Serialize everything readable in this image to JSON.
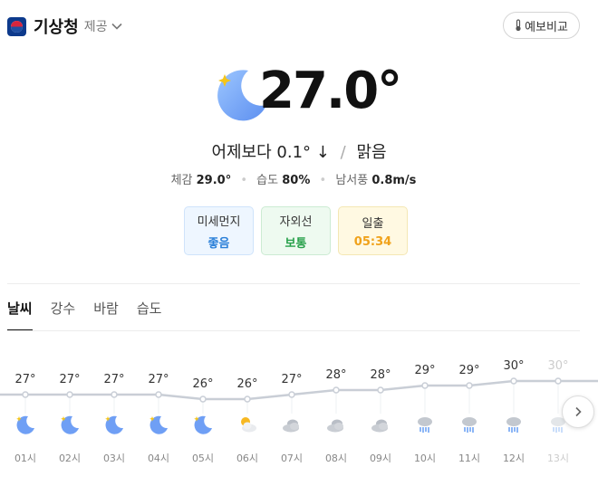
{
  "header": {
    "provider": "기상청",
    "provided_label": "제공",
    "compare_label": "예보비교"
  },
  "current": {
    "temperature": "27.0°",
    "condition_icon": "moon-icon",
    "compare_prefix": "어제보다",
    "compare_value": "0.1°",
    "compare_arrow": "↓",
    "condition": "맑음"
  },
  "details": [
    {
      "label": "체감",
      "value": "29.0°"
    },
    {
      "label": "습도",
      "value": "80%"
    },
    {
      "label": "남서풍",
      "value": "0.8m/s"
    }
  ],
  "badges": [
    {
      "label": "미세먼지",
      "value": "좋음"
    },
    {
      "label": "자외선",
      "value": "보통"
    },
    {
      "label": "일출",
      "value": "05:34"
    }
  ],
  "tabs": [
    {
      "label": "날씨",
      "active": true
    },
    {
      "label": "강수",
      "active": false
    },
    {
      "label": "바람",
      "active": false
    },
    {
      "label": "습도",
      "active": false
    }
  ],
  "hourly": [
    {
      "time": "01시",
      "temp": "27°",
      "value": 27,
      "icon": "moon-icon"
    },
    {
      "time": "02시",
      "temp": "27°",
      "value": 27,
      "icon": "moon-icon"
    },
    {
      "time": "03시",
      "temp": "27°",
      "value": 27,
      "icon": "moon-icon"
    },
    {
      "time": "04시",
      "temp": "27°",
      "value": 27,
      "icon": "moon-icon"
    },
    {
      "time": "05시",
      "temp": "26°",
      "value": 26,
      "icon": "moon-icon"
    },
    {
      "time": "06시",
      "temp": "26°",
      "value": 26,
      "icon": "partly-cloudy-sun-icon"
    },
    {
      "time": "07시",
      "temp": "27°",
      "value": 27,
      "icon": "cloudy-icon"
    },
    {
      "time": "08시",
      "temp": "28°",
      "value": 28,
      "icon": "cloudy-icon"
    },
    {
      "time": "09시",
      "temp": "28°",
      "value": 28,
      "icon": "cloudy-icon"
    },
    {
      "time": "10시",
      "temp": "29°",
      "value": 29,
      "icon": "rain-icon"
    },
    {
      "time": "11시",
      "temp": "29°",
      "value": 29,
      "icon": "rain-icon"
    },
    {
      "time": "12시",
      "temp": "30°",
      "value": 30,
      "icon": "rain-icon"
    },
    {
      "time": "13시",
      "temp": "30°",
      "value": 30,
      "icon": "rain-icon"
    }
  ]
}
